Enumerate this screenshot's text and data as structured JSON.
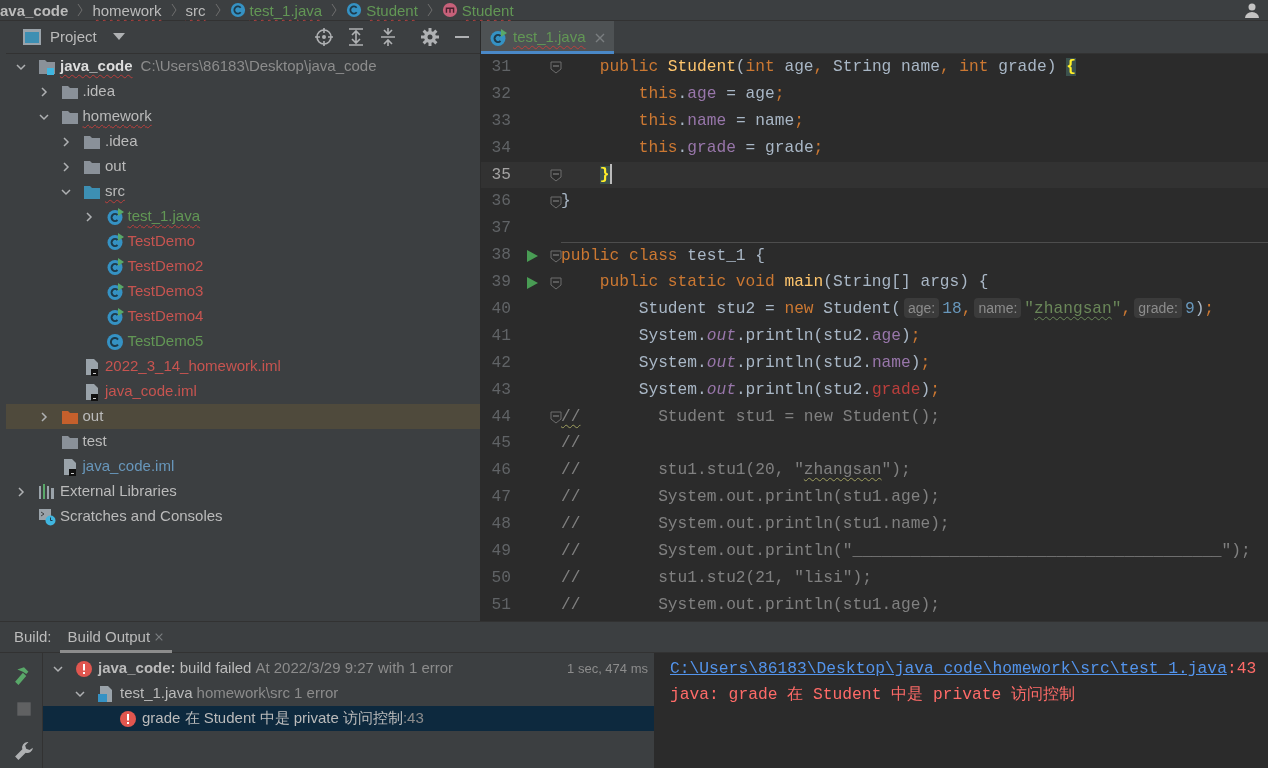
{
  "breadcrumbs": [
    {
      "label": "ava_code",
      "kind": "folder",
      "color": "#bbbbbb",
      "squiggle": false
    },
    {
      "label": "homework",
      "kind": "folder",
      "color": "#bbbbbb",
      "squiggle": true
    },
    {
      "label": "src",
      "kind": "folder",
      "color": "#bbbbbb",
      "squiggle": true
    },
    {
      "label": "test_1.java",
      "kind": "class",
      "color": "#629755",
      "squiggle": true
    },
    {
      "label": "Student",
      "kind": "class",
      "color": "#629755",
      "squiggle": true
    },
    {
      "label": "Student",
      "kind": "method",
      "color": "#629755",
      "squiggle": true
    }
  ],
  "project": {
    "title": "Project",
    "tree": [
      {
        "label": "java_code",
        "path": "C:\\Users\\86183\\Desktop\\java_code",
        "kind": "module",
        "color": "#dddddd",
        "squiggle": true,
        "selected": false,
        "expanded": true,
        "children": [
          {
            "label": ".idea",
            "kind": "folder",
            "color": "#bbbbbb",
            "squiggle": false,
            "selected": false,
            "expanded": false
          },
          {
            "label": "homework",
            "kind": "folder",
            "color": "#bbbbbb",
            "squiggle": true,
            "selected": false,
            "expanded": true,
            "children": [
              {
                "label": ".idea",
                "kind": "folder",
                "color": "#bbbbbb",
                "squiggle": false,
                "selected": false,
                "expanded": false
              },
              {
                "label": "out",
                "kind": "folder",
                "color": "#bbbbbb",
                "squiggle": false,
                "selected": false,
                "expanded": false
              },
              {
                "label": "src",
                "kind": "folder-source",
                "color": "#bbbbbb",
                "squiggle": true,
                "selected": false,
                "expanded": true,
                "children": [
                  {
                    "label": "test_1.java",
                    "kind": "class-runnable",
                    "color": "#629755",
                    "squiggle": true,
                    "selected": false,
                    "expanded": false
                  },
                  {
                    "label": "TestDemo",
                    "kind": "class-runnable",
                    "color": "#c75450",
                    "squiggle": false,
                    "selected": false
                  },
                  {
                    "label": "TestDemo2",
                    "kind": "class-runnable",
                    "color": "#c75450",
                    "squiggle": false,
                    "selected": false
                  },
                  {
                    "label": "TestDemo3",
                    "kind": "class-runnable",
                    "color": "#c75450",
                    "squiggle": false,
                    "selected": false
                  },
                  {
                    "label": "TestDemo4",
                    "kind": "class-runnable",
                    "color": "#c75450",
                    "squiggle": false,
                    "selected": false
                  },
                  {
                    "label": "TestDemo5",
                    "kind": "class",
                    "color": "#629755",
                    "squiggle": false,
                    "selected": false
                  }
                ]
              },
              {
                "label": "2022_3_14_homework.iml",
                "kind": "iml",
                "color": "#c75450",
                "squiggle": false,
                "selected": false
              },
              {
                "label": "java_code.iml",
                "kind": "iml",
                "color": "#c75450",
                "squiggle": false,
                "selected": false
              }
            ]
          },
          {
            "label": "out",
            "kind": "folder-excluded",
            "color": "#bbbbbb",
            "squiggle": false,
            "selected": true,
            "expanded": false
          },
          {
            "label": "test",
            "kind": "folder",
            "color": "#bbbbbb",
            "squiggle": false,
            "selected": false
          },
          {
            "label": "java_code.iml",
            "kind": "iml",
            "color": "#6897bb",
            "squiggle": false,
            "selected": false
          }
        ]
      },
      {
        "label": "External Libraries",
        "kind": "libraries",
        "color": "#bbbbbb",
        "squiggle": false,
        "selected": false,
        "expanded": false
      },
      {
        "label": "Scratches and Consoles",
        "kind": "scratches",
        "color": "#bbbbbb",
        "squiggle": false,
        "selected": false
      }
    ]
  },
  "editor": {
    "tabs": [
      {
        "label": "test_1.java",
        "color": "#629755",
        "selected": true
      }
    ],
    "lines": [
      {
        "n": "31",
        "run": false,
        "fold": true,
        "current": false,
        "separator": false,
        "tokens": [
          {
            "kind": "kw",
            "text": "    public "
          },
          {
            "kind": "fn",
            "text": "Student"
          },
          {
            "kind": "pl",
            "text": "("
          },
          {
            "kind": "kw",
            "text": "int "
          },
          {
            "kind": "pl",
            "text": "age"
          },
          {
            "kind": "kw",
            "text": ", "
          },
          {
            "kind": "pl",
            "text": "String name"
          },
          {
            "kind": "kw",
            "text": ", int "
          },
          {
            "kind": "pl",
            "text": "grade) "
          },
          {
            "kind": "brace",
            "text": "{"
          }
        ]
      },
      {
        "n": "32",
        "run": false,
        "fold": false,
        "current": false,
        "separator": false,
        "tokens": [
          {
            "kind": "kw",
            "text": "        this"
          },
          {
            "kind": "pl",
            "text": "."
          },
          {
            "kind": "fld",
            "text": "age"
          },
          {
            "kind": "pl",
            "text": " = age"
          },
          {
            "kind": "kw",
            "text": ";"
          }
        ]
      },
      {
        "n": "33",
        "run": false,
        "fold": false,
        "current": false,
        "separator": false,
        "tokens": [
          {
            "kind": "kw",
            "text": "        this"
          },
          {
            "kind": "pl",
            "text": "."
          },
          {
            "kind": "fld",
            "text": "name"
          },
          {
            "kind": "pl",
            "text": " = name"
          },
          {
            "kind": "kw",
            "text": ";"
          }
        ]
      },
      {
        "n": "34",
        "run": false,
        "fold": false,
        "current": false,
        "separator": false,
        "tokens": [
          {
            "kind": "kw",
            "text": "        this"
          },
          {
            "kind": "pl",
            "text": "."
          },
          {
            "kind": "fld",
            "text": "grade"
          },
          {
            "kind": "pl",
            "text": " = grade"
          },
          {
            "kind": "kw",
            "text": ";"
          }
        ]
      },
      {
        "n": "35",
        "run": false,
        "fold": true,
        "current": true,
        "separator": false,
        "tokens": [
          {
            "kind": "brace",
            "text": "    }"
          }
        ]
      },
      {
        "n": "36",
        "run": false,
        "fold": true,
        "current": false,
        "separator": false,
        "tokens": [
          {
            "kind": "pl",
            "text": "}"
          }
        ]
      },
      {
        "n": "37",
        "run": false,
        "fold": false,
        "current": false,
        "separator": false
      },
      {
        "n": "38",
        "run": true,
        "fold": true,
        "current": false,
        "separator": true,
        "tokens": [
          {
            "kind": "kw",
            "text": "public class "
          },
          {
            "kind": "pl",
            "text": "test_1 {"
          }
        ]
      },
      {
        "n": "39",
        "run": true,
        "fold": true,
        "current": false,
        "separator": false,
        "tokens": [
          {
            "kind": "kw",
            "text": "    public static void "
          },
          {
            "kind": "fn",
            "text": "main"
          },
          {
            "kind": "pl",
            "text": "(String[] args) {"
          }
        ]
      },
      {
        "n": "40",
        "run": false,
        "fold": false,
        "current": false,
        "separator": false,
        "tokens": [
          {
            "kind": "pl",
            "text": "        Student stu2 = "
          },
          {
            "kind": "kw",
            "text": "new "
          },
          {
            "kind": "pl",
            "text": "Student("
          },
          {
            "kind": "hint",
            "text": "age:"
          },
          {
            "kind": "num",
            "text": "18"
          },
          {
            "kind": "kw",
            "text": ","
          },
          {
            "kind": "hint",
            "text": "name:"
          },
          {
            "kind": "str",
            "text": "\""
          },
          {
            "kind": "strw",
            "text": "zhangsan"
          },
          {
            "kind": "str",
            "text": "\""
          },
          {
            "kind": "kw",
            "text": ","
          },
          {
            "kind": "hint",
            "text": "grade:"
          },
          {
            "kind": "num",
            "text": "9"
          },
          {
            "kind": "pl",
            "text": ")"
          },
          {
            "kind": "kw",
            "text": ";"
          }
        ]
      },
      {
        "n": "41",
        "run": false,
        "fold": false,
        "current": false,
        "separator": false,
        "tokens": [
          {
            "kind": "pl",
            "text": "        System."
          },
          {
            "kind": "static",
            "text": "out"
          },
          {
            "kind": "pl",
            "text": ".println(stu2."
          },
          {
            "kind": "fld",
            "text": "age"
          },
          {
            "kind": "pl",
            "text": ")"
          },
          {
            "kind": "kw",
            "text": ";"
          }
        ]
      },
      {
        "n": "42",
        "run": false,
        "fold": false,
        "current": false,
        "separator": false,
        "tokens": [
          {
            "kind": "pl",
            "text": "        System."
          },
          {
            "kind": "static",
            "text": "out"
          },
          {
            "kind": "pl",
            "text": ".println(stu2."
          },
          {
            "kind": "fld",
            "text": "name"
          },
          {
            "kind": "pl",
            "text": ")"
          },
          {
            "kind": "kw",
            "text": ";"
          }
        ]
      },
      {
        "n": "43",
        "run": false,
        "fold": false,
        "current": false,
        "separator": false,
        "tokens": [
          {
            "kind": "pl",
            "text": "        System."
          },
          {
            "kind": "static",
            "text": "out"
          },
          {
            "kind": "pl",
            "text": ".println(stu2."
          },
          {
            "kind": "err",
            "text": "grade"
          },
          {
            "kind": "pl",
            "text": ")"
          },
          {
            "kind": "kw",
            "text": ";"
          }
        ]
      },
      {
        "n": "44",
        "run": false,
        "fold": true,
        "current": false,
        "separator": false,
        "tokens": [
          {
            "kind": "cmw",
            "text": "//"
          },
          {
            "kind": "cm",
            "text": "        Student stu1 = new Student();"
          }
        ]
      },
      {
        "n": "45",
        "run": false,
        "fold": false,
        "current": false,
        "separator": false,
        "tokens": [
          {
            "kind": "cm",
            "text": "//"
          }
        ]
      },
      {
        "n": "46",
        "run": false,
        "fold": false,
        "current": false,
        "separator": false,
        "tokens": [
          {
            "kind": "cm",
            "text": "//        stu1.stu1(20, \""
          },
          {
            "kind": "cmw",
            "text": "zhangsan"
          },
          {
            "kind": "cm",
            "text": "\");"
          }
        ]
      },
      {
        "n": "47",
        "run": false,
        "fold": false,
        "current": false,
        "separator": false,
        "tokens": [
          {
            "kind": "cm",
            "text": "//        System.out.println(stu1.age);"
          }
        ]
      },
      {
        "n": "48",
        "run": false,
        "fold": false,
        "current": false,
        "separator": false,
        "tokens": [
          {
            "kind": "cm",
            "text": "//        System.out.println(stu1.name);"
          }
        ]
      },
      {
        "n": "49",
        "run": false,
        "fold": false,
        "current": false,
        "separator": false,
        "tokens": [
          {
            "kind": "cm",
            "text": "//        System.out.println(\"______________________________________\");"
          }
        ]
      },
      {
        "n": "50",
        "run": false,
        "fold": false,
        "current": false,
        "separator": false,
        "tokens": [
          {
            "kind": "cm",
            "text": "//        stu1.stu2(21, \"lisi\");"
          }
        ]
      },
      {
        "n": "51",
        "run": false,
        "fold": false,
        "current": false,
        "separator": false,
        "tokens": [
          {
            "kind": "cm",
            "text": "//        System.out.println(stu1.age);"
          }
        ]
      }
    ]
  },
  "build": {
    "label": "Build:",
    "tabs": [
      {
        "label": "Build Output",
        "selected": true
      }
    ],
    "toolbar": [
      {
        "kind": "hammer",
        "disabled": false
      },
      {
        "kind": "stop",
        "disabled": true
      },
      {
        "kind": "wrench",
        "disabled": false
      }
    ],
    "tree": [
      {
        "kind": "error",
        "text": "**java_code:** build failed",
        "detail": "At 2022/3/29 9:27 with 1 error",
        "time": "1 sec, 474 ms",
        "selected": false,
        "expanded": true,
        "children": [
          {
            "kind": "java-file",
            "text": "test_1.java",
            "detail": "homework\\src 1 error",
            "selected": false,
            "expanded": true,
            "children": [
              {
                "kind": "error",
                "text": "grade 在 Student 中是 private 访问控制",
                "detail": ":43",
                "selected": true
              }
            ]
          }
        ]
      }
    ],
    "console": [
      {
        "kind": "link",
        "text": "C:\\Users\\86183\\Desktop\\java_code\\homework\\src\\test_1.java",
        "suffix": ":43"
      },
      {
        "kind": "error",
        "text": "java: grade 在 Student 中是 private 访问控制"
      }
    ]
  }
}
